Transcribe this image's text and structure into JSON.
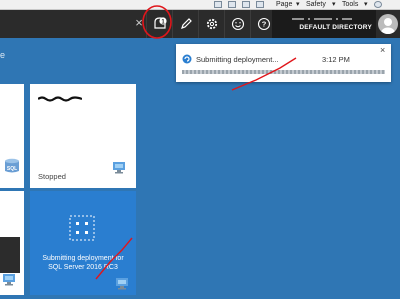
{
  "ie_bar": {
    "page_label": "Page",
    "safety_label": "Safety",
    "tools_label": "Tools",
    "chevron": "▾"
  },
  "top_bar": {
    "close_glyph": "×",
    "notification_count": "1",
    "directory_name": "DEFAULT DIRECTORY",
    "icons": [
      "notifications-icon",
      "edit-icon",
      "settings-icon",
      "smile-icon",
      "help-icon"
    ]
  },
  "notification": {
    "message": "Submitting deployment...",
    "time": "3:12 PM",
    "close_glyph": "×"
  },
  "tiles": {
    "vm_tile": {
      "status": "Stopped"
    },
    "sql_tile": {
      "badge": "SQL"
    },
    "deploy_tile": {
      "text": "Submitting deployment for SQL Server 2016 RC3"
    }
  },
  "left_hint": "e",
  "colors": {
    "portal_background": "#2f76b4",
    "top_bar": "#2b2b2b",
    "deploy_tile": "#2a7ed0",
    "annotation_red": "#e0161b"
  }
}
